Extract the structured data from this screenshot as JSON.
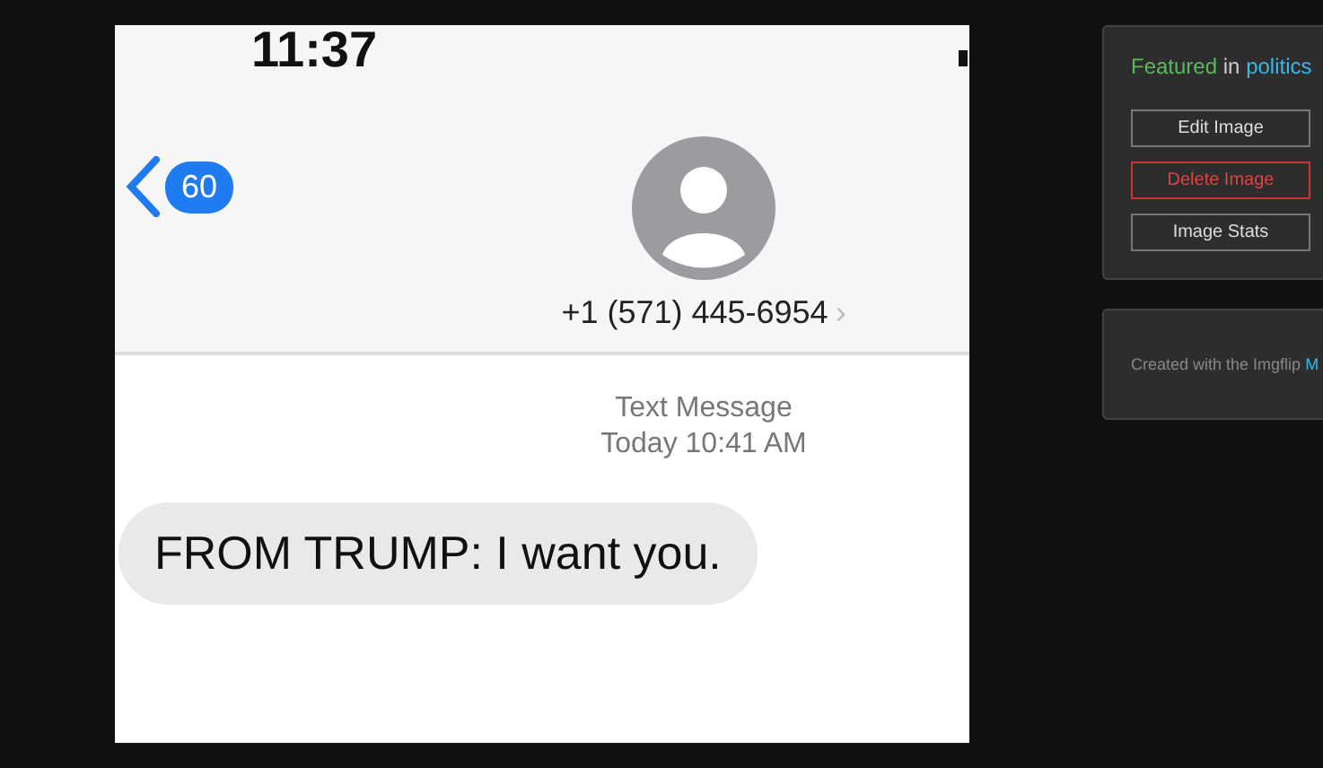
{
  "phone": {
    "time": "11:37",
    "back_count": "60",
    "contact": "+1 (571) 445-6954",
    "chevron": "›",
    "service": "Text Message",
    "timestamp": "Today 10:41 AM",
    "messages": [
      {
        "text": "FROM TRUMP: I want you.",
        "kind": "received"
      }
    ]
  },
  "sidebar": {
    "featured": {
      "prefix": "Featured",
      "joiner": "in",
      "stream": "politics"
    },
    "buttons": [
      {
        "label": "Edit Image",
        "kind": "normal"
      },
      {
        "label": "Delete Image",
        "kind": "danger"
      },
      {
        "label": "Image Stats",
        "kind": "normal"
      }
    ],
    "credit": {
      "text": "Created with the Imgflip",
      "link": "M"
    }
  }
}
